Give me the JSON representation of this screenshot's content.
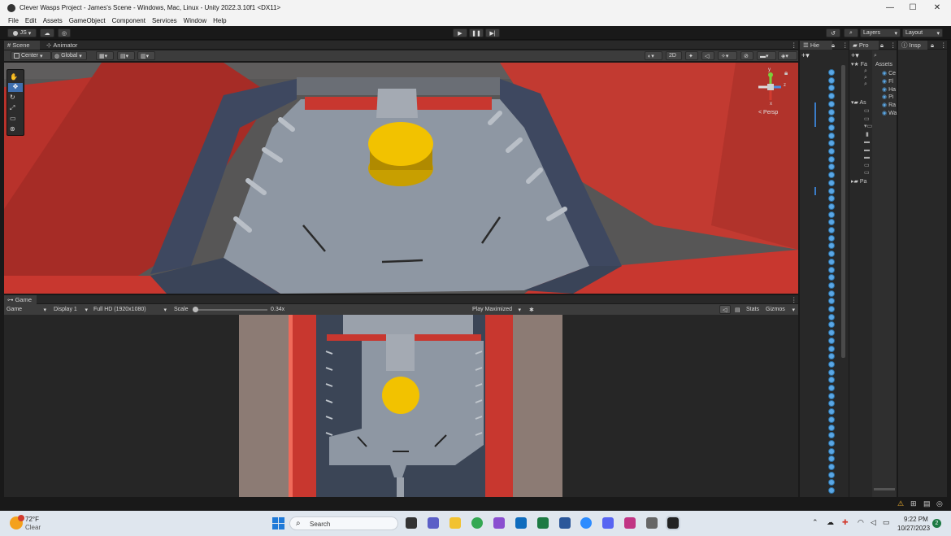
{
  "window": {
    "title": "Clever Wasps Project - James's Scene - Windows, Mac, Linux - Unity 2022.3.10f1 <DX11>",
    "min": "—",
    "max": "☐",
    "close": "✕"
  },
  "menu": [
    "File",
    "Edit",
    "Assets",
    "GameObject",
    "Component",
    "Services",
    "Window",
    "Help"
  ],
  "toolbar": {
    "account": "JS",
    "layers": "Layers",
    "layout": "Layout"
  },
  "scene": {
    "tabs": [
      "Scene",
      "Animator"
    ],
    "pivot": "Center",
    "space": "Global",
    "mode_2d": "2D",
    "gizmo_label": "< Persp",
    "axis_y": "y",
    "axis_z": "z",
    "axis_x": "x"
  },
  "game": {
    "tab": "Game",
    "view": "Game",
    "display": "Display 1",
    "resolution": "Full HD (1920x1080)",
    "scale_label": "Scale",
    "scale_value": "0.34x",
    "play_mode": "Play Maximized",
    "stats": "Stats",
    "gizmos": "Gizmos"
  },
  "hierarchy": {
    "tab": "Hie"
  },
  "project": {
    "tab": "Pro",
    "favorites": "Fa",
    "assets_folder": "As",
    "packages": "Pa",
    "assets_header": "Assets",
    "asset_items": [
      "Ce",
      "Fl",
      "Ha",
      "Pi",
      "Ra",
      "Wa"
    ]
  },
  "inspector": {
    "tab": "Insp"
  },
  "taskbar": {
    "temp": "72°F",
    "weather": "Clear",
    "search": "Search",
    "time": "9:22 PM",
    "date": "10/27/2023",
    "notifications": "2"
  },
  "colors": {
    "unity_dark": "#282828",
    "wall_red": "#c8372f",
    "floor_gray": "#8e97a3",
    "ball_yellow": "#f2c200",
    "accent_blue": "#5aa7e6"
  }
}
